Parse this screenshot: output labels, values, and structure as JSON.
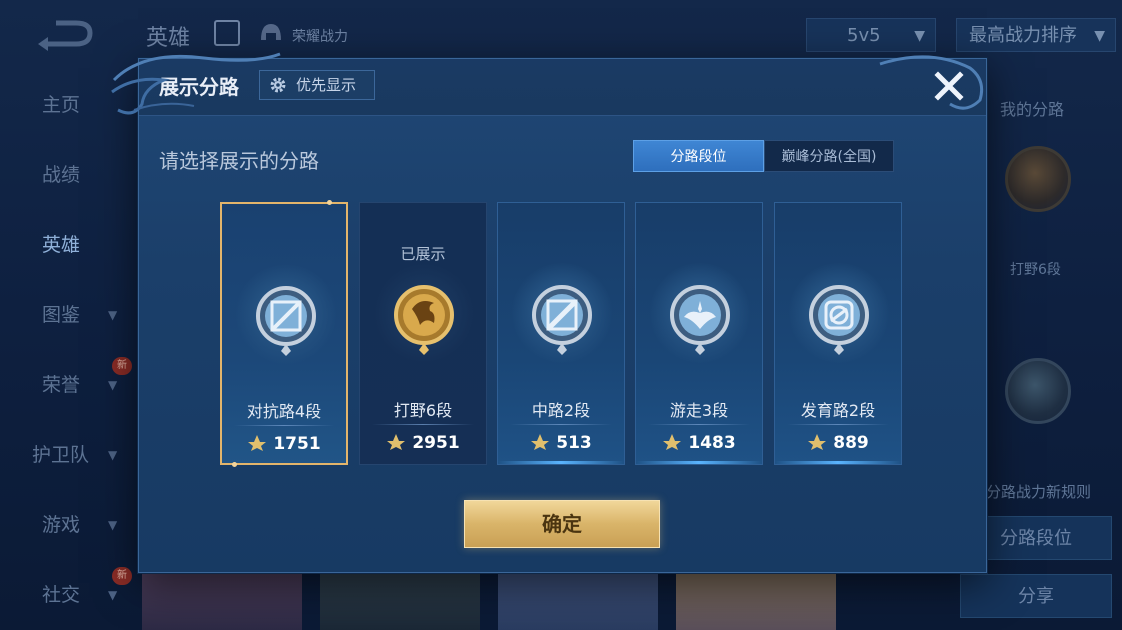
{
  "background": {
    "top_title": "英雄",
    "top_subtitle": "荣耀战力",
    "mode_dropdown": "5v5",
    "sort_dropdown": "最高战力排序",
    "sidebar": [
      {
        "label": "主页",
        "active": false,
        "chevron": false,
        "new": false
      },
      {
        "label": "战绩",
        "active": false,
        "chevron": false,
        "new": false
      },
      {
        "label": "英雄",
        "active": true,
        "chevron": false,
        "new": false
      },
      {
        "label": "图鉴",
        "active": false,
        "chevron": true,
        "new": false
      },
      {
        "label": "荣誉",
        "active": false,
        "chevron": true,
        "new": true
      },
      {
        "label": "护卫队",
        "active": false,
        "chevron": true,
        "new": false
      },
      {
        "label": "游戏",
        "active": false,
        "chevron": true,
        "new": false
      },
      {
        "label": "社交",
        "active": false,
        "chevron": true,
        "new": true
      }
    ],
    "new_badge": "新",
    "right_panel": {
      "my_lane_label": "我的分路",
      "lane_rank_label": "打野6段",
      "new_rules_label": "分路战力新规则",
      "lane_rank_button": "分路段位",
      "share_button": "分享"
    }
  },
  "dialog": {
    "title": "展示分路",
    "priority_button": "优先显示",
    "prompt": "请选择展示的分路",
    "tabs": [
      {
        "label": "分路段位",
        "active": true
      },
      {
        "label": "巅峰分路(全国)",
        "active": false
      }
    ],
    "shown_label": "已展示",
    "lanes": [
      {
        "name": "对抗路4段",
        "power": "1751",
        "selected": true,
        "shown": false,
        "medal": "clash-lane"
      },
      {
        "name": "打野6段",
        "power": "2951",
        "selected": false,
        "shown": true,
        "medal": "jungle"
      },
      {
        "name": "中路2段",
        "power": "513",
        "selected": false,
        "shown": false,
        "medal": "mid-lane"
      },
      {
        "name": "游走3段",
        "power": "1483",
        "selected": false,
        "shown": false,
        "medal": "roam"
      },
      {
        "name": "发育路2段",
        "power": "889",
        "selected": false,
        "shown": false,
        "medal": "farm-lane"
      }
    ],
    "confirm_button": "确定"
  },
  "colors": {
    "accent_gold": "#e3b56b",
    "tab_active": "#3a80cf",
    "dialog_bg": "#1c416d"
  }
}
